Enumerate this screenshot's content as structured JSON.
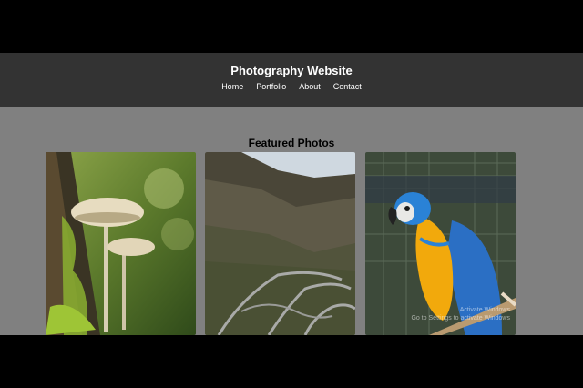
{
  "header": {
    "title": "Photography Website",
    "nav": [
      "Home",
      "Portfolio",
      "About",
      "Contact"
    ]
  },
  "main": {
    "section_title": "Featured Photos",
    "photos": [
      {
        "icon": "mushroom-photo"
      },
      {
        "icon": "mountain-road-photo"
      },
      {
        "icon": "parrot-photo"
      }
    ]
  },
  "overlay": {
    "line1": "Go to Settings to activate Windows",
    "line2": "Activate Windows"
  },
  "colors": {
    "header_bg": "#333333",
    "page_bg": "#808080",
    "frame_bg": "#000000"
  }
}
